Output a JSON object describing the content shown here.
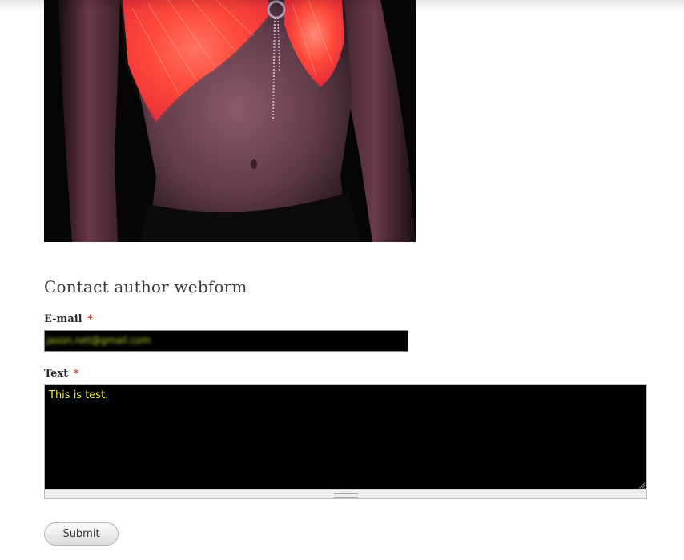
{
  "image": {
    "name": "product-photo"
  },
  "form": {
    "title": "Contact author webform",
    "email_label": "E-mail",
    "email_required": "*",
    "email_value": "jason.net@gmail.com",
    "text_label": "Text",
    "text_required": "*",
    "text_value": "This is test.",
    "submit_label": "Submit"
  },
  "colors": {
    "input_background": "#000000",
    "input_text": "#eaea3a",
    "required_marker": "#c0392b",
    "title_text": "#3b3b3b"
  },
  "icons": {
    "resize_corner": "resize-corner-icon",
    "resize_handle": "resize-handle-icon"
  }
}
